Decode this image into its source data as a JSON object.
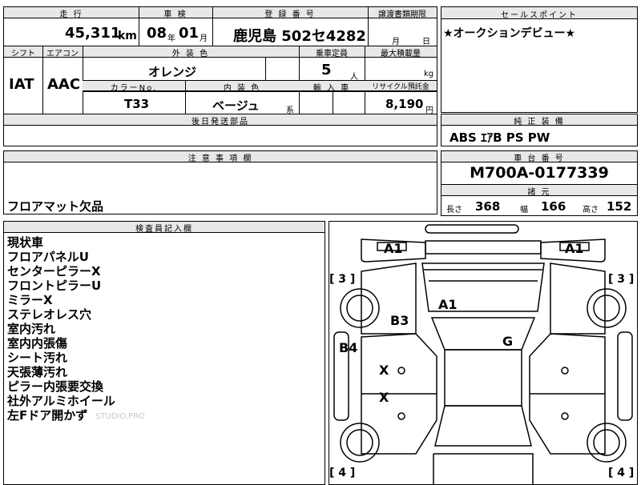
{
  "top": {
    "mileage_label": "走 行",
    "mileage": "45,311",
    "mileage_unit": "km",
    "inspection_label": "車 検",
    "inspection_year": "08",
    "year_unit": "年",
    "inspection_month": "01",
    "month_unit": "月",
    "registration_label": "登 録 番 号",
    "registration": "鹿児島 502セ4282",
    "transfer_label": "譲渡書類期限",
    "transfer_month_unit": "月",
    "transfer_day_unit": "日"
  },
  "sales_point": {
    "label": "セールスポイント",
    "text": "★オークションデビュー★"
  },
  "row2": {
    "shift_label": "シフト",
    "shift": "IAT",
    "aircon_label": "エアコン",
    "aircon": "AAC",
    "exterior_label": "外 装 色",
    "exterior": "オレンジ",
    "capacity_label": "乗車定員",
    "capacity": "5",
    "capacity_unit": "人",
    "maxload_label": "最大積載量",
    "maxload_unit": "kg",
    "colorno_label": "カラーNo.",
    "colorno": "T33",
    "interior_label": "内 装 色",
    "interior": "ベージュ",
    "interior_unit": "系",
    "import_label": "輸 入 車",
    "recycle_label": "リサイクル預託金",
    "recycle": "8,190",
    "recycle_unit": "円",
    "delivery_label": "後日発送部品"
  },
  "equipment": {
    "label": "純 正 装 備",
    "text": "ABS ｴｱB PS PW"
  },
  "notes": {
    "label": "注 意 事 項 欄",
    "text": "フロアマット欠品"
  },
  "chassis": {
    "label": "車 台 番 号",
    "number": "M700A-0177339",
    "dims_label": "諸 元",
    "length_label": "長さ",
    "length": "368",
    "width_label": "幅",
    "width": "166",
    "height_label": "高さ",
    "height": "152"
  },
  "inspector": {
    "label": "検査員記入欄",
    "items": [
      "現状車",
      "フロアパネルU",
      "センターピラーX",
      "フロントピラーU",
      "ミラーX",
      "ステレオレス穴",
      "室内汚れ",
      "室内内張傷",
      "シート汚れ",
      "天張薄汚れ",
      "ピラー内張要交換",
      "社外アルミホイール",
      "左Fドア開かず"
    ],
    "watermark": "STUDIO.PRO"
  },
  "diagram": {
    "marks": {
      "front_left": "A1",
      "front_right": "A1",
      "hood": "A1",
      "fender": "B3",
      "door": "B4",
      "roof": "G",
      "door_f": "X",
      "door_r": "X",
      "tire_fl": "[ 3 ]",
      "tire_fr": "[ 3 ]",
      "tire_rl": "[ 4 ]",
      "tire_rr": "[ 4 ]"
    }
  }
}
